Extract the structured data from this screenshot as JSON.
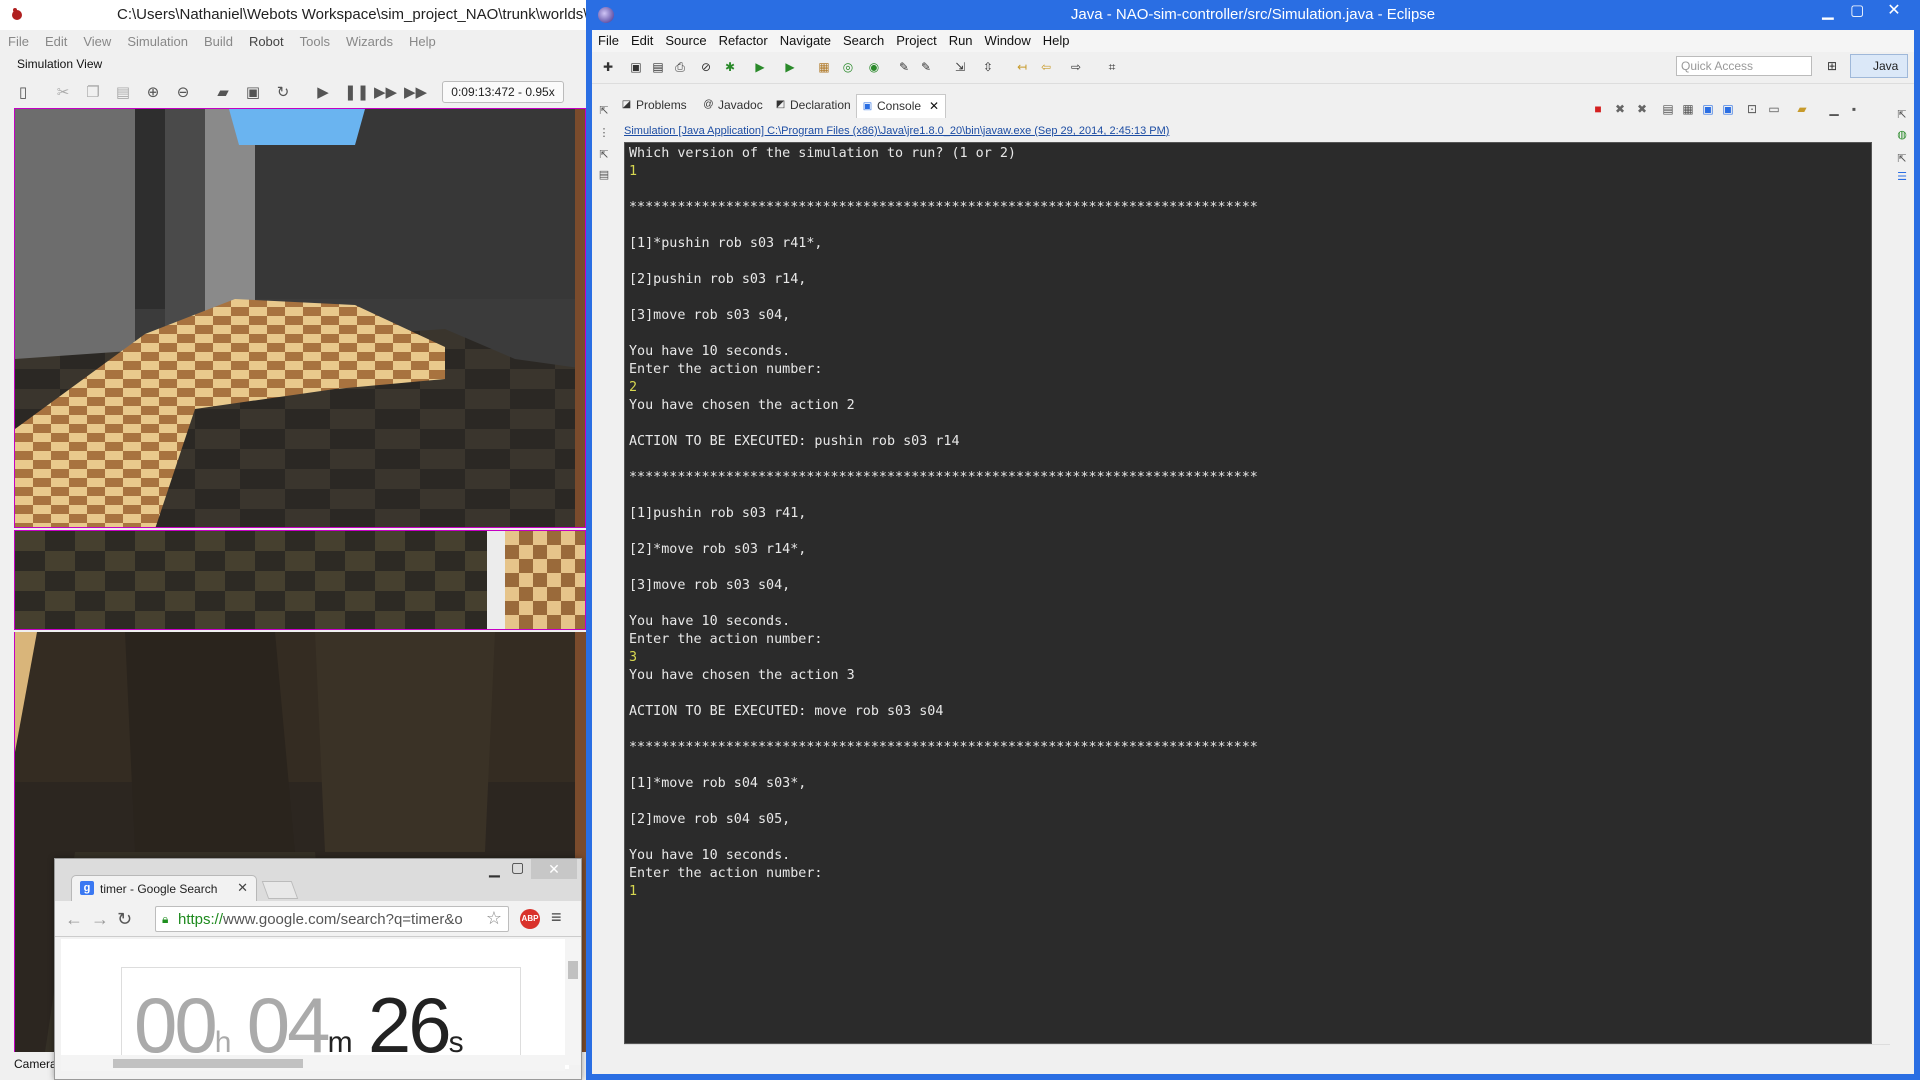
{
  "webots": {
    "title": "C:\\Users\\Nathaniel\\Webots Workspace\\sim_project_NAO\\trunk\\worlds\\",
    "menu": [
      "File",
      "Edit",
      "View",
      "Simulation",
      "Build",
      "Robot",
      "Tools",
      "Wizards",
      "Help"
    ],
    "view_label": "Simulation View",
    "time_display": "0:09:13:472  -  0.95x",
    "camera_label": "Camera",
    "toolbar_icons": [
      "toggle-panel-icon",
      "cut-icon",
      "copy-icon",
      "paste-icon",
      "add-icon",
      "remove-icon",
      "open-world-icon",
      "save-world-icon",
      "revert-icon",
      "step-icon",
      "pause-icon",
      "run-icon",
      "fast-icon"
    ]
  },
  "chrome": {
    "tab_title": "timer - Google Search",
    "tab_favicon": "g",
    "url_secure": "https://",
    "url_rest": "www.google.com/search?q=timer&o",
    "abp_label": "ABP",
    "timer": {
      "hours": "00",
      "hours_unit": "h",
      "minutes": "04",
      "minutes_unit": "m",
      "seconds": "26",
      "seconds_unit": "s"
    }
  },
  "eclipse": {
    "title": "Java - NAO-sim-controller/src/Simulation.java - Eclipse",
    "menu": [
      "File",
      "Edit",
      "Source",
      "Refactor",
      "Navigate",
      "Search",
      "Project",
      "Run",
      "Window",
      "Help"
    ],
    "quick_access_placeholder": "Quick Access",
    "perspective": "Java",
    "tabs": {
      "problems": "Problems",
      "javadoc": "Javadoc",
      "declaration": "Declaration",
      "console": "Console"
    },
    "console_header": "Simulation [Java Application] C:\\Program Files (x86)\\Java\\jre1.8.0_20\\bin\\javaw.exe (Sep 29, 2014, 2:45:13 PM)",
    "console_lines": [
      {
        "t": "Which version of the simulation to run? (1 or 2)",
        "in": false
      },
      {
        "t": "1",
        "in": true
      },
      {
        "t": "",
        "in": false
      },
      {
        "t": "******************************************************************************",
        "in": false
      },
      {
        "t": "",
        "in": false
      },
      {
        "t": "[1]*pushin rob s03 r41*,",
        "in": false
      },
      {
        "t": "",
        "in": false
      },
      {
        "t": "[2]pushin rob s03 r14,",
        "in": false
      },
      {
        "t": "",
        "in": false
      },
      {
        "t": "[3]move rob s03 s04,",
        "in": false
      },
      {
        "t": "",
        "in": false
      },
      {
        "t": "You have 10 seconds.",
        "in": false
      },
      {
        "t": "Enter the action number:",
        "in": false
      },
      {
        "t": "2",
        "in": true
      },
      {
        "t": "You have chosen the action 2",
        "in": false
      },
      {
        "t": "",
        "in": false
      },
      {
        "t": "ACTION TO BE EXECUTED: pushin rob s03 r14",
        "in": false
      },
      {
        "t": "",
        "in": false
      },
      {
        "t": "******************************************************************************",
        "in": false
      },
      {
        "t": "",
        "in": false
      },
      {
        "t": "[1]pushin rob s03 r41,",
        "in": false
      },
      {
        "t": "",
        "in": false
      },
      {
        "t": "[2]*move rob s03 r14*,",
        "in": false
      },
      {
        "t": "",
        "in": false
      },
      {
        "t": "[3]move rob s03 s04,",
        "in": false
      },
      {
        "t": "",
        "in": false
      },
      {
        "t": "You have 10 seconds.",
        "in": false
      },
      {
        "t": "Enter the action number:",
        "in": false
      },
      {
        "t": "3",
        "in": true
      },
      {
        "t": "You have chosen the action 3",
        "in": false
      },
      {
        "t": "",
        "in": false
      },
      {
        "t": "ACTION TO BE EXECUTED: move rob s03 s04",
        "in": false
      },
      {
        "t": "",
        "in": false
      },
      {
        "t": "******************************************************************************",
        "in": false
      },
      {
        "t": "",
        "in": false
      },
      {
        "t": "[1]*move rob s04 s03*,",
        "in": false
      },
      {
        "t": "",
        "in": false
      },
      {
        "t": "[2]move rob s04 s05,",
        "in": false
      },
      {
        "t": "",
        "in": false
      },
      {
        "t": "You have 10 seconds.",
        "in": false
      },
      {
        "t": "Enter the action number:",
        "in": false
      },
      {
        "t": "1",
        "in": true
      }
    ]
  },
  "colors": {
    "eclipse_titlebar": "#2a6ee3",
    "console_bg": "#2b2b2b",
    "console_text": "#e8e8e8",
    "console_input": "#d7d750",
    "camera_border": "#c400c4"
  }
}
